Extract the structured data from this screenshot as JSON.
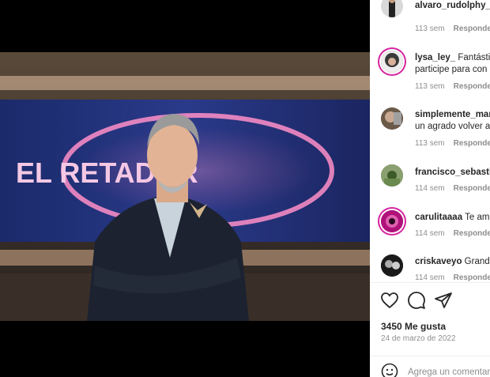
{
  "post": {
    "image_alt": "Host in dark suit with arms crossed in front of EL RETADOR set",
    "logo_text": "EL RETADOR"
  },
  "comments": [
    {
      "user": "alvaro_rudolphy_c",
      "text": "",
      "text2": "",
      "time": "113 sem",
      "reply": "Responder"
    },
    {
      "user": "lysa_ley_",
      "text": "Fantástic",
      "text2": "participe para con",
      "time": "113 sem",
      "reply": "Responder"
    },
    {
      "user": "simplemente_mar",
      "text": "",
      "text2": "un agrado volver a",
      "time": "113 sem",
      "reply": "Responder"
    },
    {
      "user": "francisco_sebastia",
      "text": "",
      "text2": "",
      "time": "114 sem",
      "reply": "Responder"
    },
    {
      "user": "carulitaaaa",
      "text": "Te am",
      "text2": "",
      "time": "114 sem",
      "reply": "Responder"
    },
    {
      "user": "criskaveyo",
      "text": "Grande",
      "text2": "",
      "time": "114 sem",
      "reply": "Responder"
    }
  ],
  "actions": {
    "like_icon": "heart-icon",
    "comment_icon": "comment-icon",
    "share_icon": "share-icon",
    "likes_label": "3450 Me gusta",
    "date": "24 de marzo de 2022",
    "add_comment_placeholder": "Agrega un comentario",
    "emoji_icon": "emoji-icon"
  },
  "colors": {
    "story_ring": "#d6249f",
    "text": "#262626",
    "muted": "#8e8e8e"
  }
}
